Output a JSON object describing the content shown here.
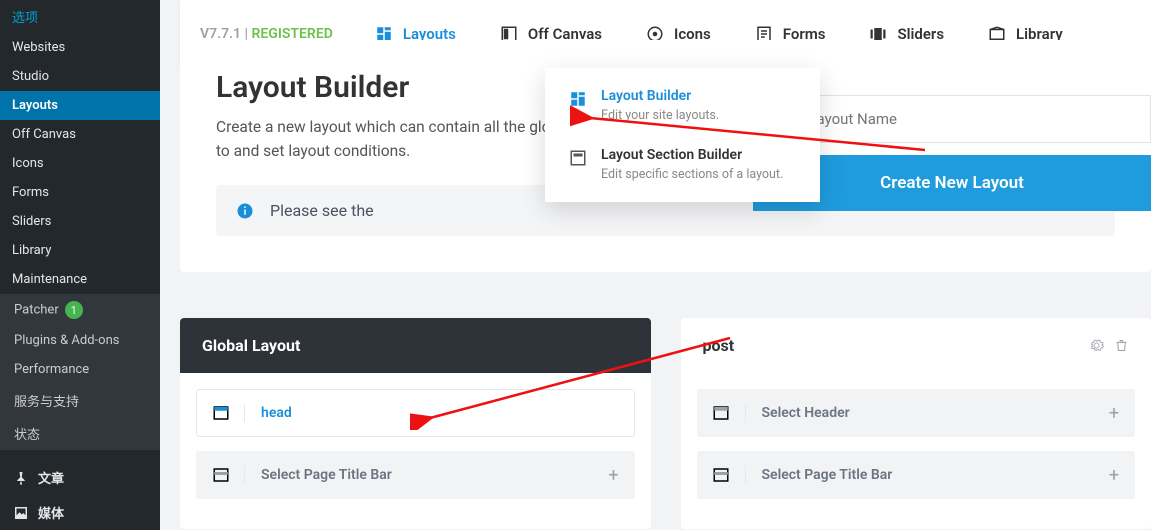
{
  "sidebar": {
    "items": [
      {
        "label": "选项"
      },
      {
        "label": "Websites"
      },
      {
        "label": "Studio"
      },
      {
        "label": "Layouts",
        "active": true
      },
      {
        "label": "Off Canvas"
      },
      {
        "label": "Icons"
      },
      {
        "label": "Forms"
      },
      {
        "label": "Sliders"
      },
      {
        "label": "Library"
      },
      {
        "label": "Maintenance"
      }
    ],
    "sub": [
      {
        "label": "Patcher",
        "badge": "1"
      },
      {
        "label": "Plugins & Add-ons"
      },
      {
        "label": "Performance"
      },
      {
        "label": "服务与支持"
      },
      {
        "label": "状态"
      }
    ],
    "bottom": [
      {
        "label": "文章",
        "icon": "pin"
      },
      {
        "label": "媒体",
        "icon": "photo"
      }
    ]
  },
  "topbar": {
    "version": "V7.7.1",
    "sep": " | ",
    "status": "REGISTERED",
    "tabs": [
      {
        "label": "Layouts",
        "icon": "layout",
        "active": true
      },
      {
        "label": "Off Canvas",
        "icon": "offcanvas"
      },
      {
        "label": "Icons",
        "icon": "icons"
      },
      {
        "label": "Forms",
        "icon": "forms"
      },
      {
        "label": "Sliders",
        "icon": "sliders"
      },
      {
        "label": "Library",
        "icon": "library"
      }
    ]
  },
  "dropdown": [
    {
      "title": "Layout Builder",
      "desc": "Edit your site layouts.",
      "icon": "layout",
      "selected": true
    },
    {
      "title": "Layout Section Builder",
      "desc": "Edit specific sections of a layout.",
      "icon": "section"
    }
  ],
  "hero": {
    "title": "Layout Builder",
    "desc_l1": "Create a new layout which can contain all the global sections",
    "desc_l2": "to and set layout conditions.",
    "notice": "Please see the"
  },
  "form": {
    "placeholder": "Enter Layout Name",
    "button": "Create New Layout"
  },
  "cards": {
    "global": {
      "title": "Global Layout",
      "slots": [
        {
          "label": "head",
          "selected": true
        },
        {
          "label": "Select Page Title Bar",
          "grey": true,
          "add": true
        }
      ]
    },
    "post": {
      "title": "post",
      "slots": [
        {
          "label": "Select Header",
          "grey": true,
          "add": true
        },
        {
          "label": "Select Page Title Bar",
          "grey": true,
          "add": true
        }
      ]
    }
  }
}
